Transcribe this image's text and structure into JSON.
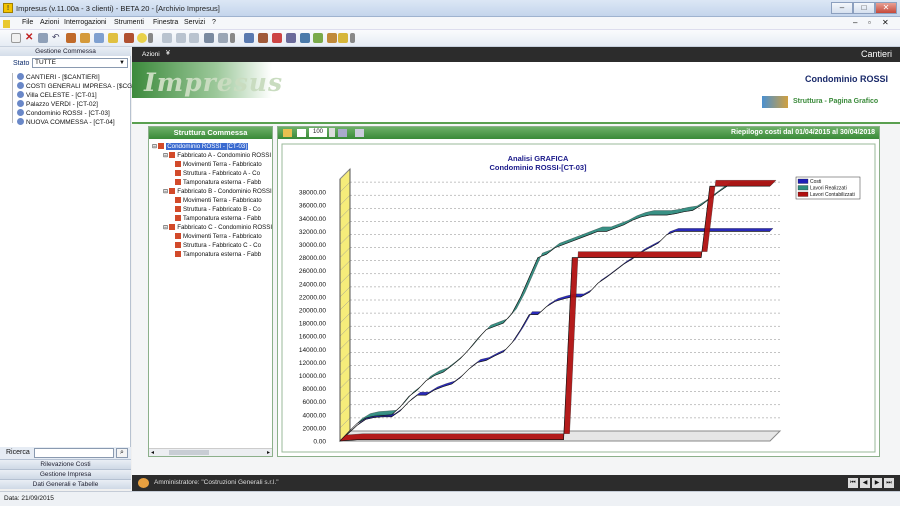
{
  "window": {
    "title": "Impresus (v.11.00a - 3 clienti) - BETA 20 - [Archivio Impresus]",
    "min": "–",
    "max": "□",
    "close": "✕",
    "inner_min": "–",
    "inner_max": "▫",
    "inner_close": "✕"
  },
  "menu": [
    "File",
    "Azioni",
    "Interrogazioni",
    "Strumenti",
    "Finestra",
    "Servizi",
    "?"
  ],
  "left": {
    "header": "Gestione Commessa",
    "stato_label": "Stato",
    "stato_value": "TUTTE",
    "items": [
      "CANTIERI - [$CANTIERI]",
      "COSTI GENERALI IMPRESA - [$CGI]",
      "Villa CELESTE - [CT-01]",
      "Palazzo VERDI - [CT-02]",
      "Condominio ROSSI - [CT-03]",
      "NUOVA COMMESSA - [CT-04]"
    ],
    "ricerca_label": "Ricerca",
    "nav": [
      "Rilevazione Costi",
      "Gestione Impresa",
      "Dati Generali e Tabelle"
    ]
  },
  "status": {
    "date": "Data: 21/09/2015"
  },
  "main": {
    "azioni": "Azioni",
    "cantieri": "Cantieri",
    "logo": "Impresus",
    "project_title": "Condominio ROSSI",
    "subtitle": "Struttura - Pagina Grafico",
    "tree_header": "Struttura Commessa",
    "tree": [
      {
        "t": "Condominio ROSSI - [CT-03]",
        "lvl": 0,
        "sel": true
      },
      {
        "t": "Fabbricato A - Condominio ROSSI",
        "lvl": 1
      },
      {
        "t": "Movimenti Terra - Fabbricato",
        "lvl": 2
      },
      {
        "t": "Struttura - Fabbricato A - Co",
        "lvl": 2
      },
      {
        "t": "Tamponatura esterna - Fabb",
        "lvl": 2
      },
      {
        "t": "Fabbricato B - Condominio ROSSI",
        "lvl": 1
      },
      {
        "t": "Movimenti Terra - Fabbricato",
        "lvl": 2
      },
      {
        "t": "Struttura - Fabbricato B - Co",
        "lvl": 2
      },
      {
        "t": "Tamponatura esterna - Fabb",
        "lvl": 2
      },
      {
        "t": "Fabbricato C - Condominio ROSSI",
        "lvl": 1
      },
      {
        "t": "Movimenti Terra - Fabbricato",
        "lvl": 2
      },
      {
        "t": "Struttura - Fabbricato C - Co",
        "lvl": 2
      },
      {
        "t": "Tamponatura esterna - Fabb",
        "lvl": 2
      }
    ],
    "zoom": "100",
    "riepilogo": "Riepilogo costi dal 01/04/2015 al 30/04/2018",
    "admin": "Amministratore: \"Costruzioni Generali s.r.l.\""
  },
  "chart_data": {
    "type": "line",
    "title": "Analisi GRAFICA",
    "subtitle": "Condominio ROSSI-[CT-03]",
    "ylim": [
      0,
      40000
    ],
    "yticks": [
      "0.00",
      "2000.00",
      "4000.00",
      "6000.00",
      "8000.00",
      "10000.00",
      "12000.00",
      "14000.00",
      "16000.00",
      "18000.00",
      "20000.00",
      "22000.00",
      "24000.00",
      "26000.00",
      "28000.00",
      "30000.00",
      "32000.00",
      "34000.00",
      "36000.00",
      "38000.00"
    ],
    "legend_position": "top-right",
    "grid": true,
    "x": [
      0,
      2,
      4,
      6,
      8,
      10,
      12,
      14,
      16,
      18,
      20,
      22,
      24,
      26,
      28,
      30,
      32,
      34,
      36,
      38,
      40,
      42,
      44,
      46,
      48,
      50,
      52,
      54,
      56,
      58,
      60,
      62,
      64,
      66,
      68,
      70,
      72,
      74,
      76,
      78,
      80,
      82,
      84,
      86,
      88,
      90,
      92,
      94,
      96,
      98,
      100
    ],
    "series": [
      {
        "name": "Costi",
        "color": "#1f1fb8",
        "values": [
          0,
          1200,
          2400,
          3300,
          3600,
          3700,
          3700,
          4600,
          6000,
          7000,
          7000,
          7800,
          8300,
          8700,
          9700,
          11000,
          12000,
          12300,
          13000,
          13600,
          15000,
          17000,
          19300,
          19300,
          20500,
          21300,
          21700,
          22000,
          22000,
          22700,
          24100,
          25000,
          26000,
          27000,
          27800,
          28800,
          29500,
          30200,
          31500,
          32000,
          32000,
          32000,
          32000,
          32000,
          32000,
          32000,
          32000,
          32000,
          32000,
          32000,
          32000
        ]
      },
      {
        "name": "Lavori Realizzati",
        "color": "#2f8c7f",
        "values": [
          0,
          1400,
          2700,
          3500,
          3800,
          3900,
          4000,
          5200,
          6800,
          7800,
          9200,
          10000,
          10500,
          11500,
          12600,
          14000,
          15600,
          17000,
          17500,
          18000,
          19500,
          22000,
          25000,
          28000,
          28500,
          29500,
          30000,
          30500,
          31000,
          31500,
          32000,
          32000,
          32500,
          33000,
          33700,
          34200,
          34500,
          34500,
          34500,
          34700,
          35000,
          35200,
          36000,
          37000,
          38000,
          38900,
          38900,
          38900,
          38900,
          38900,
          38900
        ]
      },
      {
        "name": "Lavori Contabilizzati",
        "color": "#b01010",
        "values": [
          0,
          100,
          200,
          200,
          200,
          200,
          200,
          200,
          200,
          200,
          200,
          200,
          200,
          200,
          200,
          200,
          200,
          200,
          200,
          200,
          200,
          200,
          200,
          200,
          200,
          200,
          200,
          28000,
          28000,
          28000,
          28000,
          28000,
          28000,
          28000,
          28000,
          28000,
          28000,
          28000,
          28000,
          28000,
          28000,
          28000,
          28000,
          38900,
          38900,
          38900,
          38900,
          38900,
          38900,
          38900,
          38900
        ]
      }
    ]
  }
}
